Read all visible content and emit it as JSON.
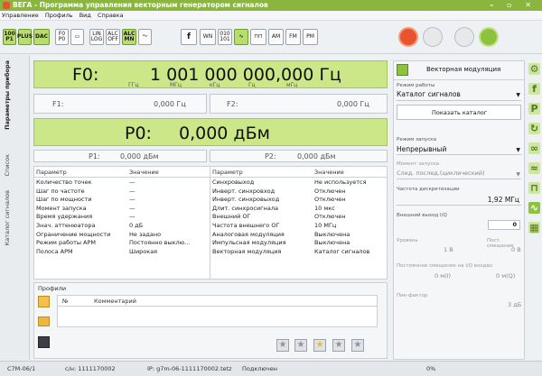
{
  "window": {
    "title": "ВЕГА - Программа управления векторным генератором сигналов"
  },
  "menu": [
    "Управление",
    "Профиль",
    "Вид",
    "Справка"
  ],
  "toolbar": {
    "left": [
      "100 P1",
      "PLUS",
      "DAC",
      "F0 P0",
      "",
      "LIN LOG",
      "ALC OFF",
      "ALC MN",
      ""
    ],
    "right": [
      "f",
      "WN",
      "010 101",
      "",
      "",
      "AM",
      "FM",
      "PM"
    ]
  },
  "left_tabs": [
    "Параметры прибора",
    "Список",
    "Каталог сигналов"
  ],
  "f0": {
    "label": "F0:",
    "value": "1 001 000 000,000 Гц",
    "subs": [
      "ГГц",
      "МГц",
      "кГц",
      "Гц",
      "мГц"
    ]
  },
  "f1": {
    "label": "F1:",
    "value": "0,000 Гц"
  },
  "f2": {
    "label": "F2:",
    "value": "0,000 Гц"
  },
  "p0": {
    "label": "P0:",
    "value": "0,000 дБм"
  },
  "p1": {
    "label": "P1:",
    "value": "0,000 дБм"
  },
  "p2": {
    "label": "P2:",
    "value": "0,000 дБм"
  },
  "table": {
    "col1": "Параметр",
    "col2": "Значение",
    "left_params": [
      "Количество точек",
      "Шаг по частоте",
      "Шаг по мощности",
      "Момент запуска",
      "Время удержания",
      "Знач. аттенюатора",
      "Ограничение мощности",
      "Режим работы АРМ",
      "Полоса АРМ"
    ],
    "left_values": [
      "—",
      "—",
      "—",
      "—",
      "—",
      "0 дБ",
      "Не задано",
      "Постоянно выклю...",
      "Широкая"
    ],
    "right_params": [
      "Синхровыход",
      "Инверт. синхровход",
      "Инверт. синхровыход",
      "Длит. синхросигнала",
      "Внешний ОГ",
      "Частота внешнего ОГ",
      "Аналоговая модуляция",
      "Импульсная модуляция",
      "Векторная модуляция"
    ],
    "right_values": [
      "Не используется",
      "Отключен",
      "Отключен",
      "10 мкс",
      "Отключен",
      "10 МГц",
      "Выключена",
      "Выключена",
      "Каталог сигналов"
    ]
  },
  "profiles": {
    "title": "Профили",
    "col_num": "№",
    "col_comment": "Комментарий"
  },
  "right_panel": {
    "title": "Векторная модуляция",
    "mode_label": "Режим работы",
    "mode_value": "Каталог сигналов",
    "show_catalog": "Показать каталог",
    "trigger_label": "Режим запуска",
    "trigger_value": "Непрерывный",
    "moment_label": "Момент запуска",
    "moment_value": "След. послед.(циклический)",
    "sample_label": "Частота дискретизации",
    "sample_value": "1,92 МГц",
    "ext_label": "Внешний выход I/Q",
    "ext_value": "0",
    "level_label": "Уровень",
    "dc_label": "Пост. смещение",
    "level_value": "1 В",
    "dc_value": "0 В",
    "iq_label": "Постоянное смещение на I/Q входах",
    "i_value": "0 м(I)",
    "q_value": "0 м(Q)",
    "pf_label": "Пик-фактор",
    "pf_value": "3 дБ"
  },
  "status": {
    "device": "С7М-06/1",
    "serial": "с/н: 1111170002",
    "ip": "IP: g7m-06-1111170002.tetz",
    "conn": "Подключен",
    "percent": "0%"
  },
  "icons": [
    "app-icon",
    "reset-icon",
    "arrow-icon",
    "rf-icon",
    "mod-on-icon"
  ],
  "colors": {
    "accent": "#8ab63f",
    "panel": "#cbe787",
    "reset": "#e9542d"
  }
}
